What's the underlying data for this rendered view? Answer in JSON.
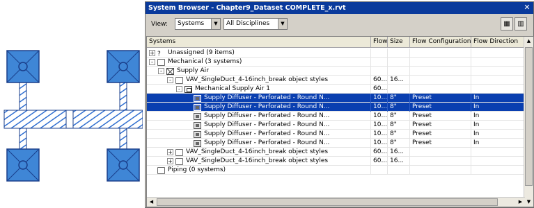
{
  "window": {
    "title": "System Browser - Chapter9_Dataset COMPLETE_x.rvt",
    "close_icon": "close-icon"
  },
  "toolbar": {
    "view_label": "View:",
    "view_select": "Systems",
    "discipline_select": "All Disciplines",
    "button1_icon": "column-settings-icon",
    "button2_icon": "autofit-columns-icon"
  },
  "columns": [
    "Systems",
    "Flow",
    "Size",
    "Flow Configuration",
    "Flow Direction"
  ],
  "rows": [
    {
      "indent": 0,
      "expander": "+",
      "icon": "unassigned",
      "name": "Unassigned (9 items)",
      "flow": "",
      "size": "",
      "config": "",
      "direction": "",
      "selected": false
    },
    {
      "indent": 0,
      "expander": "-",
      "icon": "folder",
      "name": "Mechanical (3 systems)",
      "flow": "",
      "size": "",
      "config": "",
      "direction": "",
      "selected": false
    },
    {
      "indent": 1,
      "expander": "-",
      "icon": "xbox",
      "name": "Supply Air",
      "flow": "",
      "size": "",
      "config": "",
      "direction": "",
      "selected": false
    },
    {
      "indent": 2,
      "expander": "-",
      "icon": "folder",
      "name": "VAV_SingleDuct_4-16inch_break object styles",
      "flow": "60...",
      "size": "16...",
      "config": "",
      "direction": "",
      "selected": false
    },
    {
      "indent": 3,
      "expander": "-",
      "icon": "sys",
      "name": "Mechanical Supply Air 1",
      "flow": "60...",
      "size": "",
      "config": "",
      "direction": "",
      "selected": false
    },
    {
      "indent": 4,
      "expander": "",
      "icon": "dev",
      "name": "Supply Diffuser - Perforated - Round N...",
      "flow": "10...",
      "size": "8\"",
      "config": "Preset",
      "direction": "In",
      "selected": true
    },
    {
      "indent": 4,
      "expander": "",
      "icon": "dev",
      "name": "Supply Diffuser - Perforated - Round N...",
      "flow": "10...",
      "size": "8\"",
      "config": "Preset",
      "direction": "In",
      "selected": true
    },
    {
      "indent": 4,
      "expander": "",
      "icon": "dev",
      "name": "Supply Diffuser - Perforated - Round N...",
      "flow": "10...",
      "size": "8\"",
      "config": "Preset",
      "direction": "In",
      "selected": false
    },
    {
      "indent": 4,
      "expander": "",
      "icon": "dev",
      "name": "Supply Diffuser - Perforated - Round N...",
      "flow": "10...",
      "size": "8\"",
      "config": "Preset",
      "direction": "In",
      "selected": false
    },
    {
      "indent": 4,
      "expander": "",
      "icon": "dev",
      "name": "Supply Diffuser - Perforated - Round N...",
      "flow": "10...",
      "size": "8\"",
      "config": "Preset",
      "direction": "In",
      "selected": false
    },
    {
      "indent": 4,
      "expander": "",
      "icon": "dev",
      "name": "Supply Diffuser - Perforated - Round N...",
      "flow": "10...",
      "size": "8\"",
      "config": "Preset",
      "direction": "In",
      "selected": false
    },
    {
      "indent": 2,
      "expander": "+",
      "icon": "folder",
      "name": "VAV_SingleDuct_4-16inch_break object styles",
      "flow": "60...",
      "size": "16...",
      "config": "",
      "direction": "",
      "selected": false
    },
    {
      "indent": 2,
      "expander": "+",
      "icon": "folder",
      "name": "VAV_SingleDuct_4-16inch_break object styles",
      "flow": "60...",
      "size": "16...",
      "config": "",
      "direction": "",
      "selected": false
    },
    {
      "indent": 0,
      "expander": "",
      "icon": "folder",
      "name": "Piping (0 systems)",
      "flow": "",
      "size": "",
      "config": "",
      "direction": "",
      "selected": false
    }
  ],
  "colors": {
    "selection": "#0a3fb0",
    "title_bar": "#0a3a9c",
    "duct_fill": "#3f86d6",
    "duct_stroke": "#1a3e8a"
  }
}
